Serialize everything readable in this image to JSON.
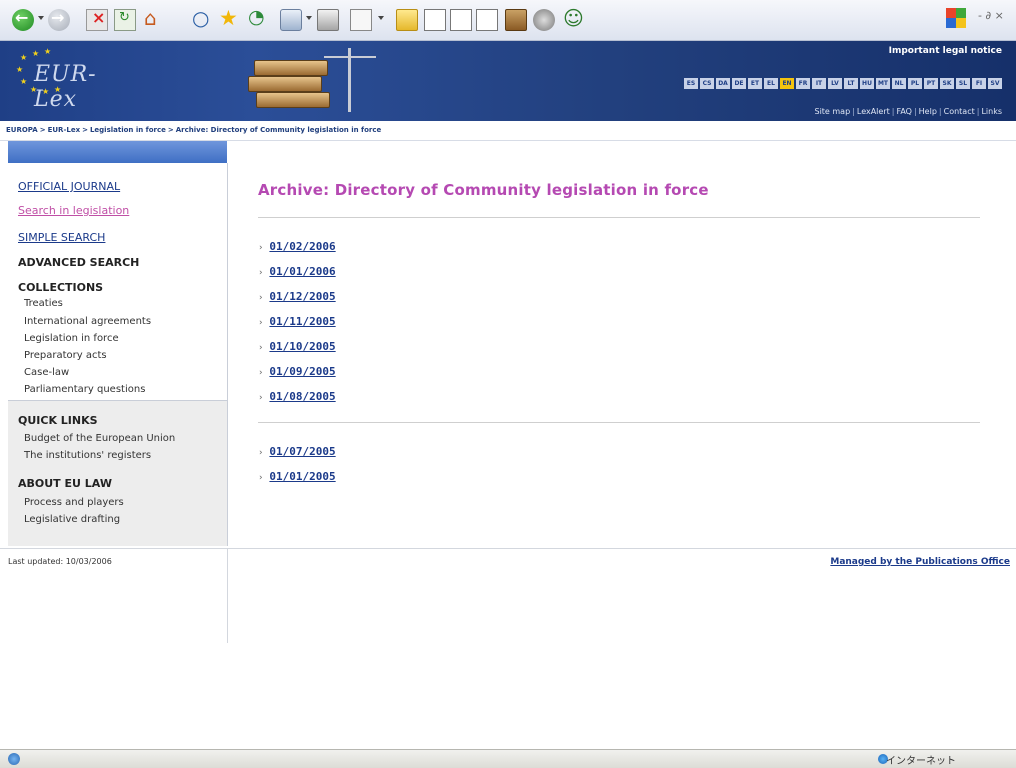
{
  "browser": {
    "toolbar_icons": [
      "back-icon",
      "forward-icon",
      "stop-icon",
      "refresh-icon",
      "home-icon",
      "search-icon",
      "favorites-icon",
      "history-icon",
      "mail-icon",
      "print-icon",
      "edit-icon",
      "folder-icon",
      "document-icon",
      "document-icon",
      "document-icon",
      "book-icon",
      "discuss-icon",
      "messenger-icon"
    ],
    "window_controls": "- ∂ ×"
  },
  "header": {
    "logo_text": "EUR-Lex",
    "legal_notice": "Important legal notice",
    "languages": [
      "ES",
      "CS",
      "DA",
      "DE",
      "ET",
      "EL",
      "EN",
      "FR",
      "IT",
      "LV",
      "LT",
      "HU",
      "MT",
      "NL",
      "PL",
      "PT",
      "SK",
      "SL",
      "FI",
      "SV"
    ],
    "active_language": "EN",
    "util_nav": [
      "Site map",
      "LexAlert",
      "FAQ",
      "Help",
      "Contact",
      "Links"
    ]
  },
  "breadcrumb": [
    "EUROPA",
    "EUR-Lex",
    "Legislation in force",
    "Archive: Directory of Community legislation in force"
  ],
  "sidebar": {
    "official_journal": "OFFICIAL JOURNAL",
    "search_in_legislation": "Search in legislation",
    "simple_search": "SIMPLE SEARCH",
    "advanced_search": "ADVANCED SEARCH",
    "collections_title": "COLLECTIONS",
    "collections": [
      "Treaties",
      "International agreements",
      "Legislation in force",
      "Preparatory acts",
      "Case-law",
      "Parliamentary questions"
    ],
    "quick_links_title": "QUICK LINKS",
    "quick_links": [
      "Budget of the European Union",
      "The institutions' registers"
    ],
    "about_title": "ABOUT EU LAW",
    "about_links": [
      "Process and players",
      "Legislative drafting"
    ]
  },
  "main": {
    "title": "Archive: Directory of Community legislation in force",
    "dates_group1": [
      "01/02/2006",
      "01/01/2006",
      "01/12/2005",
      "01/11/2005",
      "01/10/2005",
      "01/09/2005",
      "01/08/2005"
    ],
    "dates_group2": [
      "01/07/2005",
      "01/01/2005"
    ]
  },
  "footer": {
    "last_updated": "Last updated: 10/03/2006",
    "managed_by": "Managed by the Publications Office"
  },
  "statusbar": {
    "zone": "インターネット"
  }
}
